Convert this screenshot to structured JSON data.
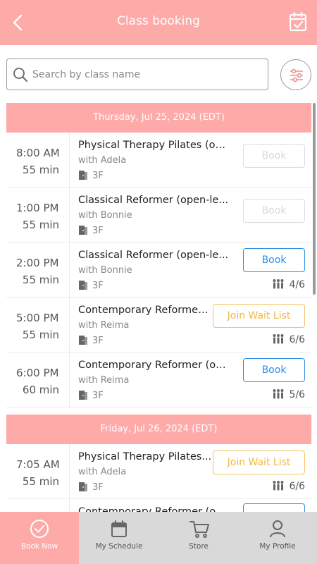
{
  "header": {
    "title": "Class booking"
  },
  "search": {
    "placeholder": "Search by class name"
  },
  "days": [
    {
      "date_label": "Thursday, Jul 25, 2024 (EDT)",
      "classes": [
        {
          "time": "8:00  AM",
          "duration": "55 min",
          "name": "Physical Therapy Pilates (op...",
          "instructor": "with Adela",
          "room": "3F",
          "button": "Book",
          "button_state": "disabled",
          "capacity": ""
        },
        {
          "time": "1:00  PM",
          "duration": "55 min",
          "name": "Classical Reformer (open-le...",
          "instructor": "with Bonnie",
          "room": "3F",
          "button": "Book",
          "button_state": "disabled",
          "capacity": ""
        },
        {
          "time": "2:00  PM",
          "duration": "55 min",
          "name": "Classical Reformer (open-le...",
          "instructor": "with Bonnie",
          "room": "3F",
          "button": "Book",
          "button_state": "book",
          "capacity": "4/6"
        },
        {
          "time": "5:00  PM",
          "duration": "55 min",
          "name": "Contemporary Reformer...",
          "instructor": "with Reima",
          "room": "3F",
          "button": "Join Wait List",
          "button_state": "wait",
          "capacity": "6/6"
        },
        {
          "time": "6:00  PM",
          "duration": "60 min",
          "name": "Contemporary Reformer (op...",
          "instructor": "with Reima",
          "room": "3F",
          "button": "Book",
          "button_state": "book",
          "capacity": "5/6"
        }
      ]
    },
    {
      "date_label": "Friday, Jul 26, 2024 (EDT)",
      "classes": [
        {
          "time": "7:05  AM",
          "duration": "55 min",
          "name": "Physical Therapy Pilates...",
          "instructor": "with Adela",
          "room": "3F",
          "button": "Join Wait List",
          "button_state": "wait",
          "capacity": "6/6"
        },
        {
          "time": "",
          "duration": "",
          "name": "Contemporary Reformer (op...",
          "instructor": "",
          "room": "",
          "button": "",
          "button_state": "book",
          "capacity": ""
        }
      ]
    }
  ],
  "tabs": [
    {
      "label": "Book Now",
      "icon": "check-circle-icon",
      "active": true
    },
    {
      "label": "My Schedule",
      "icon": "calendar-icon",
      "active": false
    },
    {
      "label": "Store",
      "icon": "cart-icon",
      "active": false
    },
    {
      "label": "My Profile",
      "icon": "person-icon",
      "active": false
    }
  ],
  "colors": {
    "brand": "#fdaaa8",
    "book": "#2d8ee8",
    "waitlist": "#f0b848",
    "disabled": "#dcdcdc"
  }
}
